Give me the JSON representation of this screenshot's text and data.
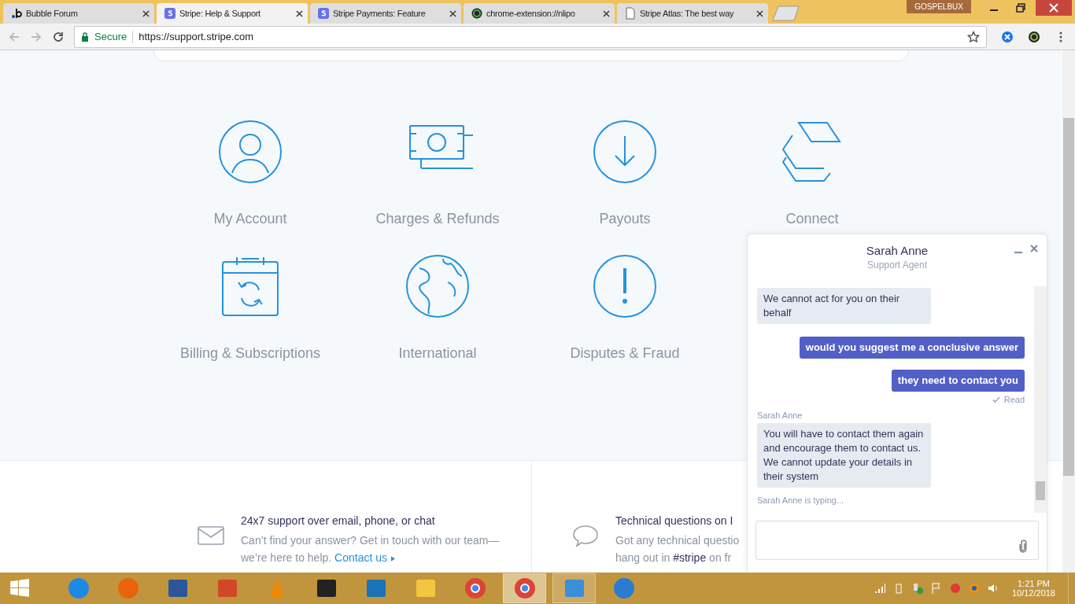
{
  "browser": {
    "tabs": [
      {
        "title": "Bubble Forum",
        "kind": "bubble",
        "selected": false
      },
      {
        "title": "Stripe: Help & Support",
        "kind": "stripe",
        "selected": true
      },
      {
        "title": "Stripe Payments: Feature",
        "kind": "stripe",
        "selected": false
      },
      {
        "title": "chrome-extension://nlipo",
        "kind": "ring",
        "selected": false
      },
      {
        "title": "Stripe Atlas: The best way",
        "kind": "page",
        "selected": false
      }
    ],
    "profile_badge": "GOSPELBUX",
    "address": {
      "security": "Secure",
      "url": "https://support.stripe.com"
    }
  },
  "categories": [
    {
      "label": "My Account",
      "kind": "person"
    },
    {
      "label": "Charges & Refunds",
      "kind": "money"
    },
    {
      "label": "Payouts",
      "kind": "download"
    },
    {
      "label": "Connect",
      "kind": "layers"
    },
    {
      "label": "Billing & Subscriptions",
      "kind": "calendar"
    },
    {
      "label": "International",
      "kind": "globe"
    },
    {
      "label": "Disputes & Fraud",
      "kind": "alert"
    }
  ],
  "support": [
    {
      "kind": "mail",
      "title": "24x7 support over email, phone, or chat",
      "text": "Can’t find your answer? Get in touch with our team—we’re here to help.",
      "link": "Contact us"
    },
    {
      "kind": "speech",
      "title": "Technical questions on I",
      "lines": [
        "Got any technical questio",
        "hang out in **#stripe** on fr"
      ]
    }
  ],
  "chat": {
    "agent": "Sarah Anne",
    "role": "Support Agent",
    "messages": [
      {
        "kind": "agent",
        "text": "We cannot act for you on their behalf"
      },
      {
        "kind": "user",
        "text": "would you suggest me a conclusive answer"
      },
      {
        "kind": "user",
        "text": "they need to contact you",
        "receipt": "Read"
      },
      {
        "kind": "agent",
        "sender": "Sarah Anne",
        "text": "You will have to contact them again and encourage them to contact us. We cannot update your details in their system"
      }
    ],
    "typing": "Sarah Anne is typing..."
  },
  "taskbar": {
    "apps": [
      {
        "kind": "ie",
        "running": false,
        "selected": false
      },
      {
        "kind": "firefox",
        "running": false,
        "selected": false
      },
      {
        "kind": "word",
        "running": false,
        "selected": false
      },
      {
        "kind": "office",
        "running": false,
        "selected": false
      },
      {
        "kind": "vlc",
        "running": false,
        "selected": false
      },
      {
        "kind": "movie",
        "running": false,
        "selected": false
      },
      {
        "kind": "bracket",
        "running": false,
        "selected": false
      },
      {
        "kind": "folder",
        "running": false,
        "selected": false
      },
      {
        "kind": "chrome",
        "running": false,
        "selected": false
      },
      {
        "kind": "chrome-app",
        "running": true,
        "selected": true
      },
      {
        "kind": "window",
        "running": true,
        "selected": false
      },
      {
        "kind": "orb",
        "running": false,
        "selected": false
      }
    ],
    "time": "1:21 PM",
    "date": "10/12/2018"
  }
}
